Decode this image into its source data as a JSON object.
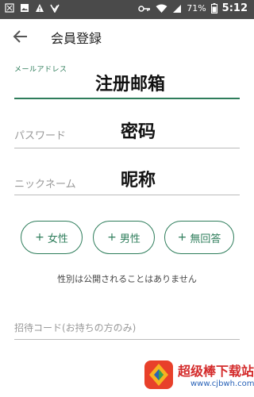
{
  "status_bar": {
    "battery": "71%",
    "time": "5:12",
    "icons": [
      "nfc-icon",
      "image-icon",
      "warning-icon",
      "check-icon",
      "key-icon",
      "wifi-icon",
      "signal-icon",
      "battery-icon"
    ]
  },
  "app_bar": {
    "title": "会員登録",
    "back_icon": "arrow-left-icon"
  },
  "form": {
    "email": {
      "label": "メールアドレス",
      "overlay": "注册邮箱"
    },
    "password": {
      "placeholder": "パスワード",
      "overlay": "密码"
    },
    "nickname": {
      "placeholder": "ニックネーム",
      "overlay": "昵称"
    },
    "gender_options": [
      {
        "label": "女性"
      },
      {
        "label": "男性"
      },
      {
        "label": "無回答"
      }
    ],
    "gender_note": "性別は公開されることはありません",
    "invite": {
      "placeholder": "招待コード(お持ちの方のみ)"
    }
  },
  "watermark": {
    "title": "超级棒下载站",
    "url": "www.cjbwh.com"
  },
  "colors": {
    "accent": "#2e7d5b",
    "status_bar": "#4a4a4a",
    "watermark_red": "#d42b2b",
    "watermark_blue": "#2a63b8"
  }
}
